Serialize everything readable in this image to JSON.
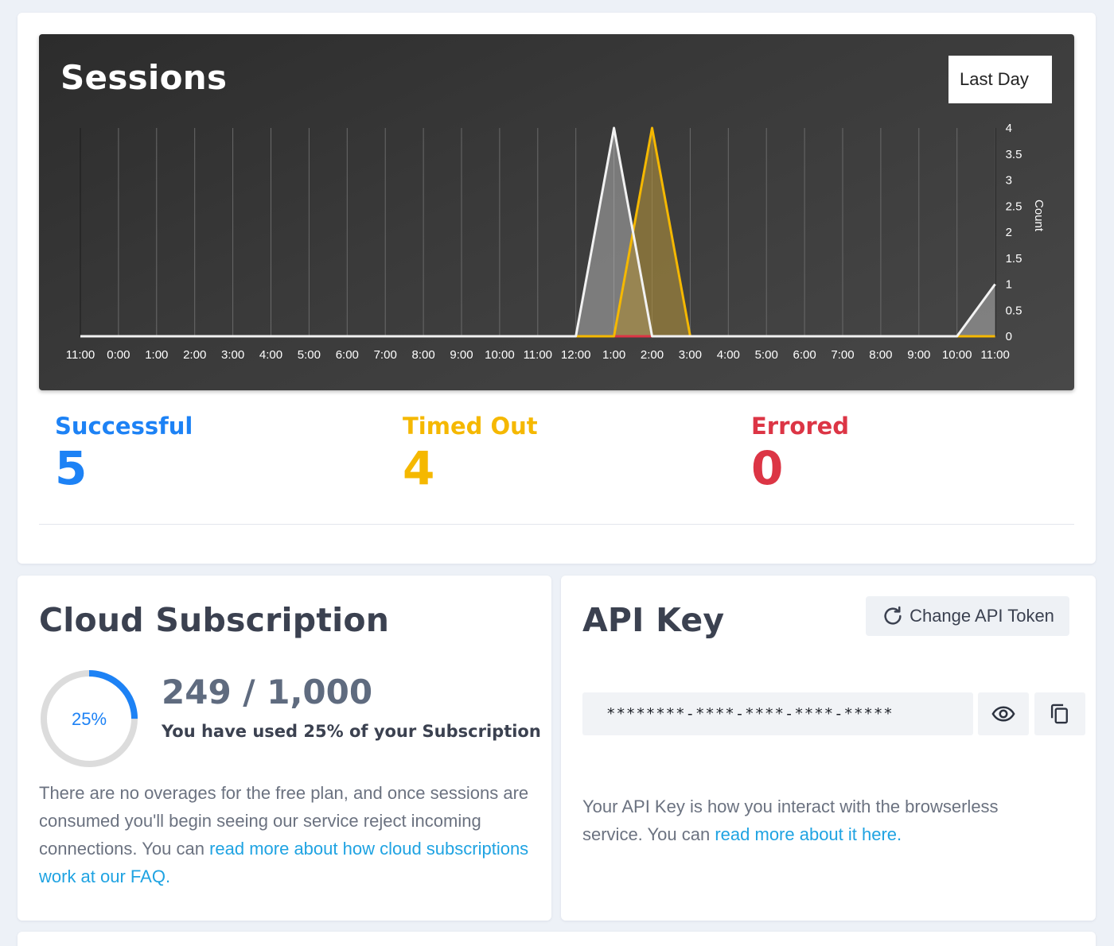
{
  "sessions": {
    "title": "Sessions",
    "range_selected": "Last Day"
  },
  "chart_data": {
    "type": "area",
    "title": "Sessions",
    "x_labels": [
      "11:00",
      "0:00",
      "1:00",
      "2:00",
      "3:00",
      "4:00",
      "5:00",
      "6:00",
      "7:00",
      "8:00",
      "9:00",
      "10:00",
      "11:00",
      "12:00",
      "1:00",
      "2:00",
      "3:00",
      "4:00",
      "5:00",
      "6:00",
      "7:00",
      "8:00",
      "9:00",
      "10:00",
      "11:00"
    ],
    "ylabel": "Count",
    "ylim": [
      0,
      4
    ],
    "y_ticks": [
      "4",
      "3.5",
      "3",
      "2.5",
      "2",
      "1.5",
      "1",
      "0.5",
      "0"
    ],
    "grid": true,
    "series": [
      {
        "name": "Successful",
        "color": "#f2f2f2",
        "values": [
          0,
          0,
          0,
          0,
          0,
          0,
          0,
          0,
          0,
          0,
          0,
          0,
          0,
          0,
          4,
          0,
          0,
          0,
          0,
          0,
          0,
          0,
          0,
          0,
          1
        ]
      },
      {
        "name": "Timed Out",
        "color": "#f5b800",
        "values": [
          0,
          0,
          0,
          0,
          0,
          0,
          0,
          0,
          0,
          0,
          0,
          0,
          0,
          0,
          0,
          4,
          0,
          0,
          0,
          0,
          0,
          0,
          0,
          0,
          0
        ]
      },
      {
        "name": "Errored",
        "color": "#dc3545",
        "values": [
          0,
          0,
          0,
          0,
          0,
          0,
          0,
          0,
          0,
          0,
          0,
          0,
          0,
          0,
          0,
          0,
          0,
          0,
          0,
          0,
          0,
          0,
          0,
          0,
          0
        ]
      }
    ]
  },
  "stats": {
    "successful": {
      "label": "Successful",
      "value": "5",
      "color": "#1d82f5"
    },
    "timed_out": {
      "label": "Timed Out",
      "value": "4",
      "color": "#f5b800"
    },
    "errored": {
      "label": "Errored",
      "value": "0",
      "color": "#dc3545"
    }
  },
  "subscription": {
    "title": "Cloud Subscription",
    "percent": 25,
    "percent_label": "25%",
    "usage": "249 / 1,000",
    "note": "You have used 25% of your Subscription",
    "text": "There are no overages for the free plan, and once sessions are consumed you'll begin seeing our service reject incoming connections. You can ",
    "link": "read more about how cloud subscriptions work at our FAQ."
  },
  "api": {
    "title": "API Key",
    "change_button": "Change API Token",
    "masked_key": "********-****-****-****-*****",
    "text": "Your API Key is how you interact with the browserless service. You can ",
    "link": "read more about it here.",
    "icons": {
      "refresh": "refresh-icon",
      "reveal": "eye-icon",
      "copy": "copy-icon"
    }
  }
}
